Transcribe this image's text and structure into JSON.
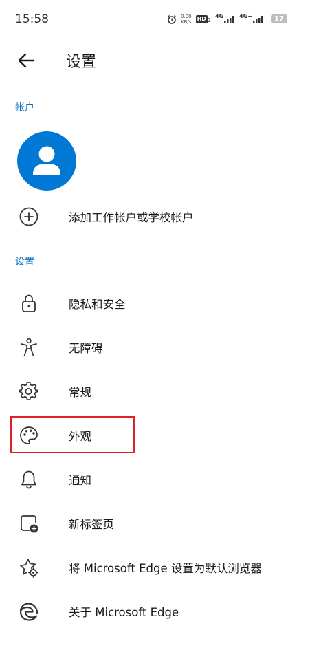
{
  "status_bar": {
    "time": "15:58",
    "net_speed_value": "0.00",
    "net_speed_unit": "KB/s",
    "hd_label": "HD",
    "hd_sub": "2",
    "sim1_label": "4G",
    "sim2_label": "4G+",
    "battery": "17"
  },
  "header": {
    "title": "设置",
    "back_icon": "arrow-left-icon"
  },
  "account_section": {
    "label": "帐户",
    "add_account_label": "添加工作帐户或学校帐户"
  },
  "settings_section": {
    "label": "设置",
    "items": [
      {
        "label": "隐私和安全",
        "icon": "lock-icon"
      },
      {
        "label": "无障碍",
        "icon": "accessibility-icon"
      },
      {
        "label": "常规",
        "icon": "gear-icon"
      },
      {
        "label": "外观",
        "icon": "palette-icon"
      },
      {
        "label": "通知",
        "icon": "bell-icon"
      },
      {
        "label": "新标签页",
        "icon": "new-tab-icon"
      },
      {
        "label": "将 Microsoft Edge 设置为默认浏览器",
        "icon": "star-gear-icon"
      },
      {
        "label": "关于 Microsoft Edge",
        "icon": "edge-logo-icon"
      }
    ]
  },
  "colors": {
    "accent": "#0f6cbd",
    "avatar_bg": "#0078d4",
    "highlight_border": "#e0202a"
  }
}
